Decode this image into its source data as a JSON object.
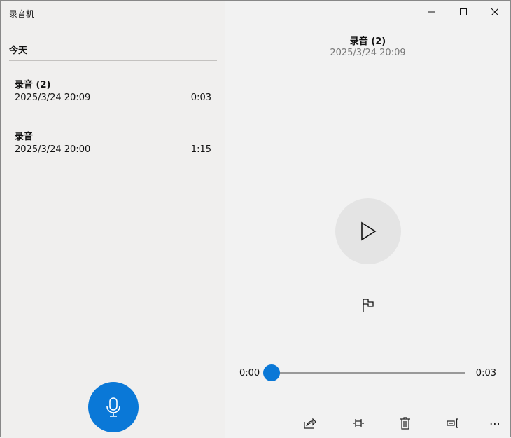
{
  "app": {
    "title": "录音机"
  },
  "list": {
    "group": "今天",
    "items": [
      {
        "name": "录音 (2)",
        "date": "2025/3/24 20:09",
        "duration": "0:03"
      },
      {
        "name": "录音",
        "date": "2025/3/24 20:00",
        "duration": "1:15"
      }
    ]
  },
  "detail": {
    "name": "录音 (2)",
    "date": "2025/3/24 20:09",
    "current": "0:00",
    "total": "0:03",
    "progress": 0
  },
  "colors": {
    "accent": "#0a78d7"
  }
}
